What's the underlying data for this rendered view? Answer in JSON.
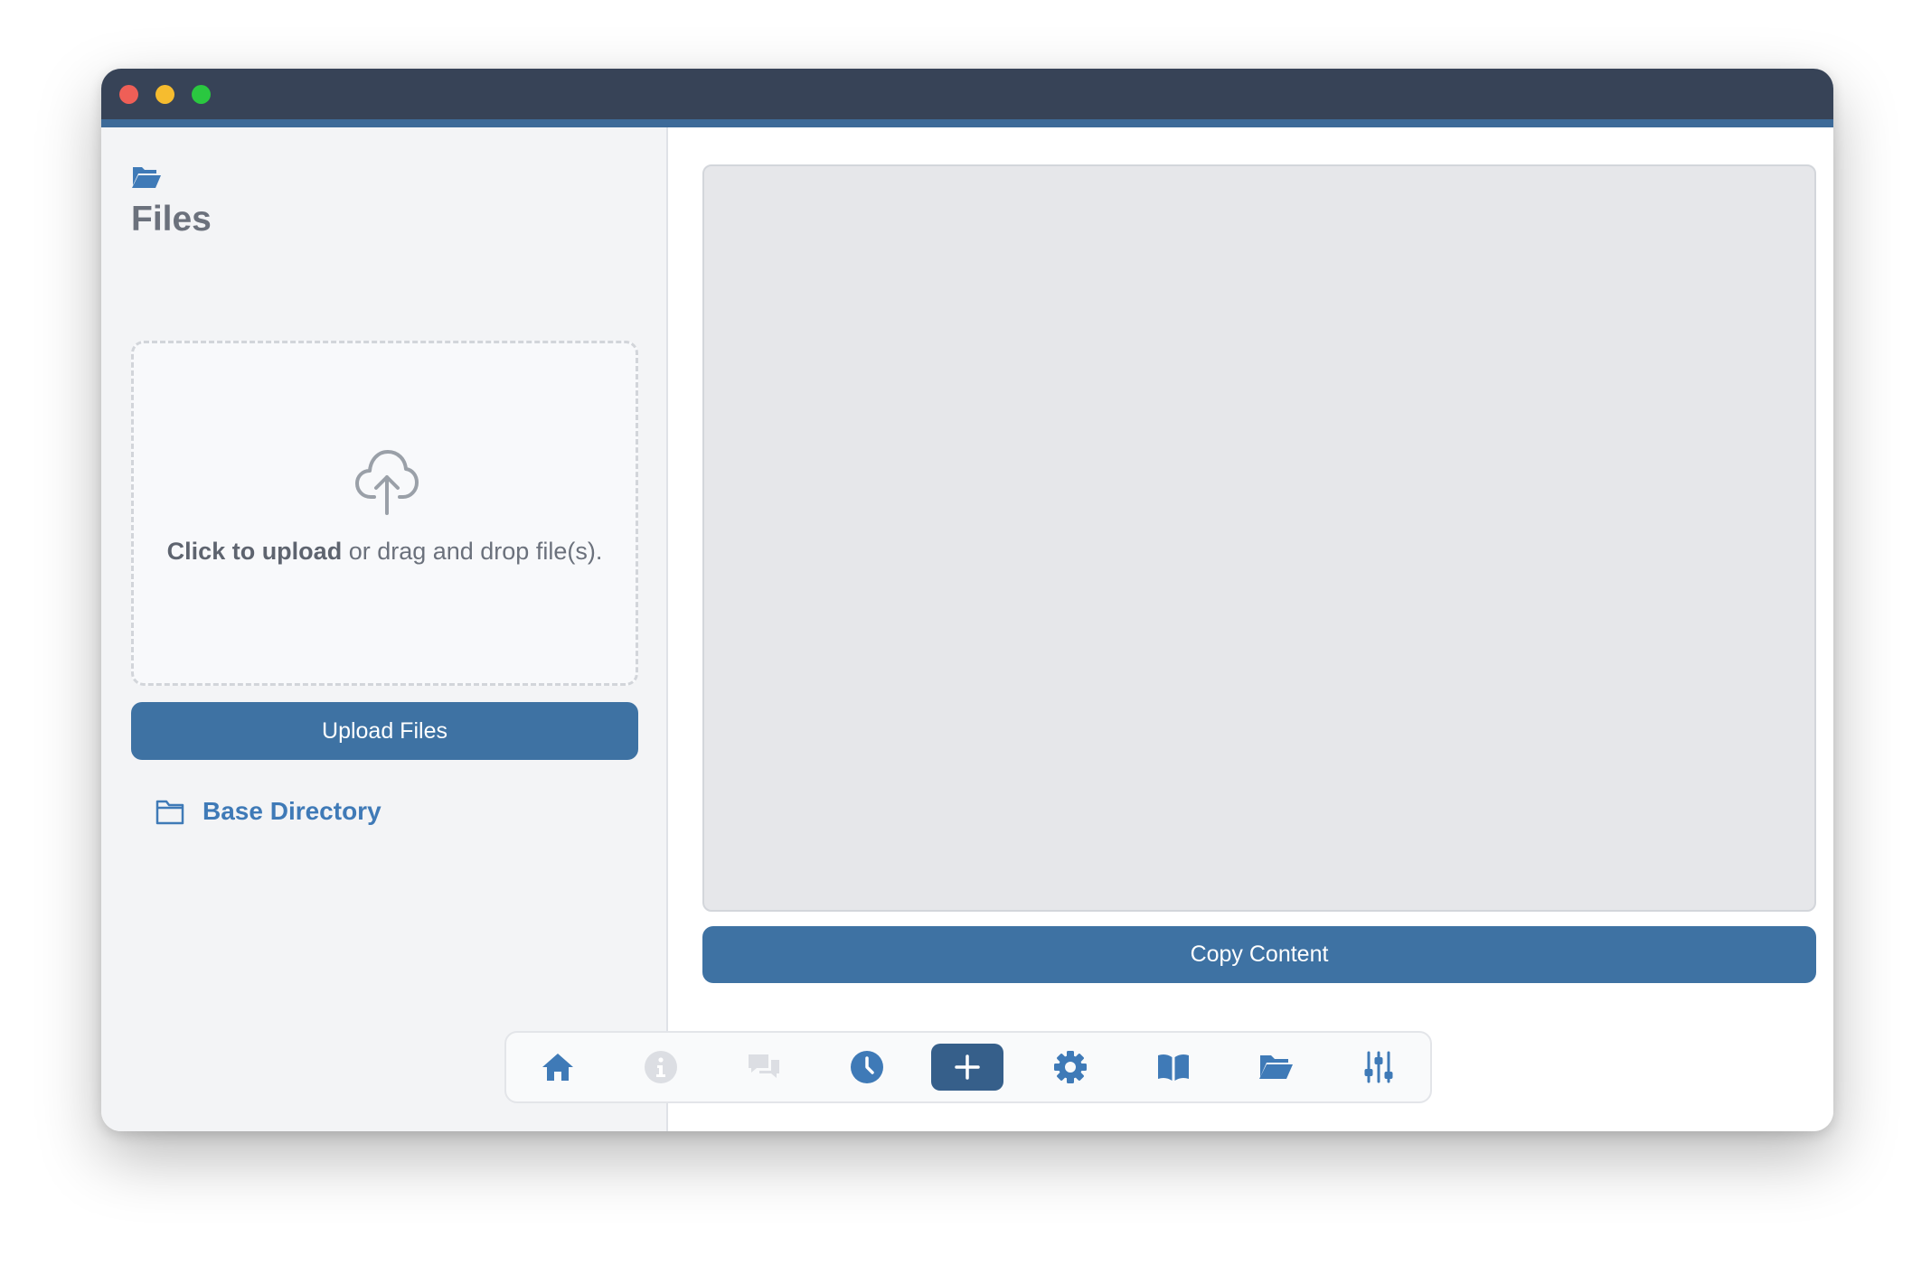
{
  "sidebar": {
    "title": "Files",
    "title_icon": "folder-open-icon",
    "dropzone": {
      "icon": "cloud-upload-icon",
      "strong_text": "Click to upload",
      "rest_text": " or drag and drop file(s)."
    },
    "upload_button_label": "Upload Files",
    "directory": {
      "icon": "folder-icon",
      "label": "Base Directory"
    }
  },
  "main": {
    "content_text": "",
    "copy_button_label": "Copy Content"
  },
  "bottom_nav": {
    "items": [
      {
        "icon": "home-icon",
        "state": "enabled"
      },
      {
        "icon": "info-icon",
        "state": "disabled"
      },
      {
        "icon": "chat-icon",
        "state": "disabled"
      },
      {
        "icon": "clock-icon",
        "state": "enabled"
      },
      {
        "icon": "plus-icon",
        "state": "active"
      },
      {
        "icon": "gear-icon",
        "state": "enabled"
      },
      {
        "icon": "book-icon",
        "state": "enabled"
      },
      {
        "icon": "folder-open-icon",
        "state": "enabled"
      },
      {
        "icon": "sliders-icon",
        "state": "enabled"
      }
    ]
  },
  "colors": {
    "titlebar": "#374357",
    "accent": "#3e72a3",
    "link": "#3f7ab7",
    "icon_disabled": "#dcdee3"
  }
}
